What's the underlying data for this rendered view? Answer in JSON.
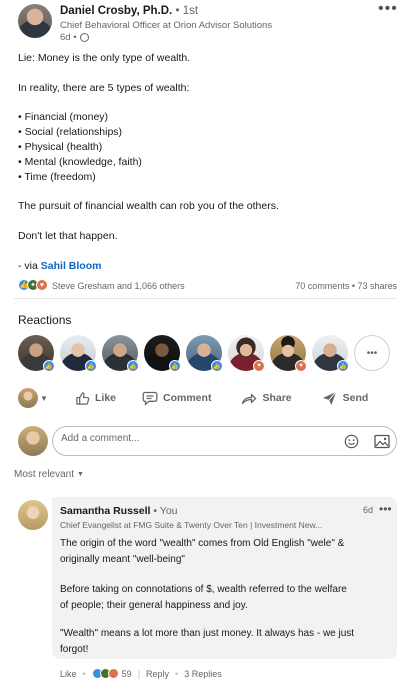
{
  "post": {
    "author_name": "Daniel Crosby, Ph.D.",
    "author_degree": "• 1st",
    "author_title": "Chief Behavioral Officer at Orion Advisor Solutions",
    "time": "6d •",
    "more_label": "•••",
    "lines": [
      "Lie: Money is the only type of wealth.",
      "In reality, there are 5 types of wealth:",
      "• Financial (money)",
      "• Social (relationships)",
      "• Physical (health)",
      "• Mental (knowledge, faith)",
      "• Time (freedom)",
      "The pursuit of financial wealth can rob you of the others.",
      "Don't let that happen."
    ],
    "via_prefix": "- via ",
    "via_link": "Sahil Bloom",
    "reactors_text": "Steve Gresham and 1,066 others",
    "counts_text": "70 comments • 73 shares"
  },
  "reactions": {
    "heading": "Reactions",
    "more_label": "•••"
  },
  "actions": {
    "like": "Like",
    "comment": "Comment",
    "share": "Share",
    "send": "Send"
  },
  "composer": {
    "placeholder": "Add a comment..."
  },
  "sort": {
    "label": "Most relevant"
  },
  "comment": {
    "name": "Samantha Russell",
    "you_label": "• You",
    "time": "6d",
    "more_label": "•••",
    "headline": "Chief Evangelist at FMG Suite & Twenty Over Ten | Investment New...",
    "lines": [
      "The origin of the word \"wealth\" comes from Old English \"wele\" &",
      "originally meant \"well-being\"",
      "Before taking on connotations of $, wealth referred to the welfare",
      "of people; their general happiness and joy.",
      "\"Wealth\" means a lot more than just money. It always has - we just",
      "forgot!"
    ],
    "like_label": "Like",
    "reaction_count": "59",
    "reply_label": "Reply",
    "replies_label": "3 Replies"
  },
  "colors": {
    "link_blue": "#0a66c2",
    "like_blue": "#378fe9",
    "love_red": "#df704d",
    "celebrate_green": "#44712e",
    "text_secondary": "#666666"
  }
}
